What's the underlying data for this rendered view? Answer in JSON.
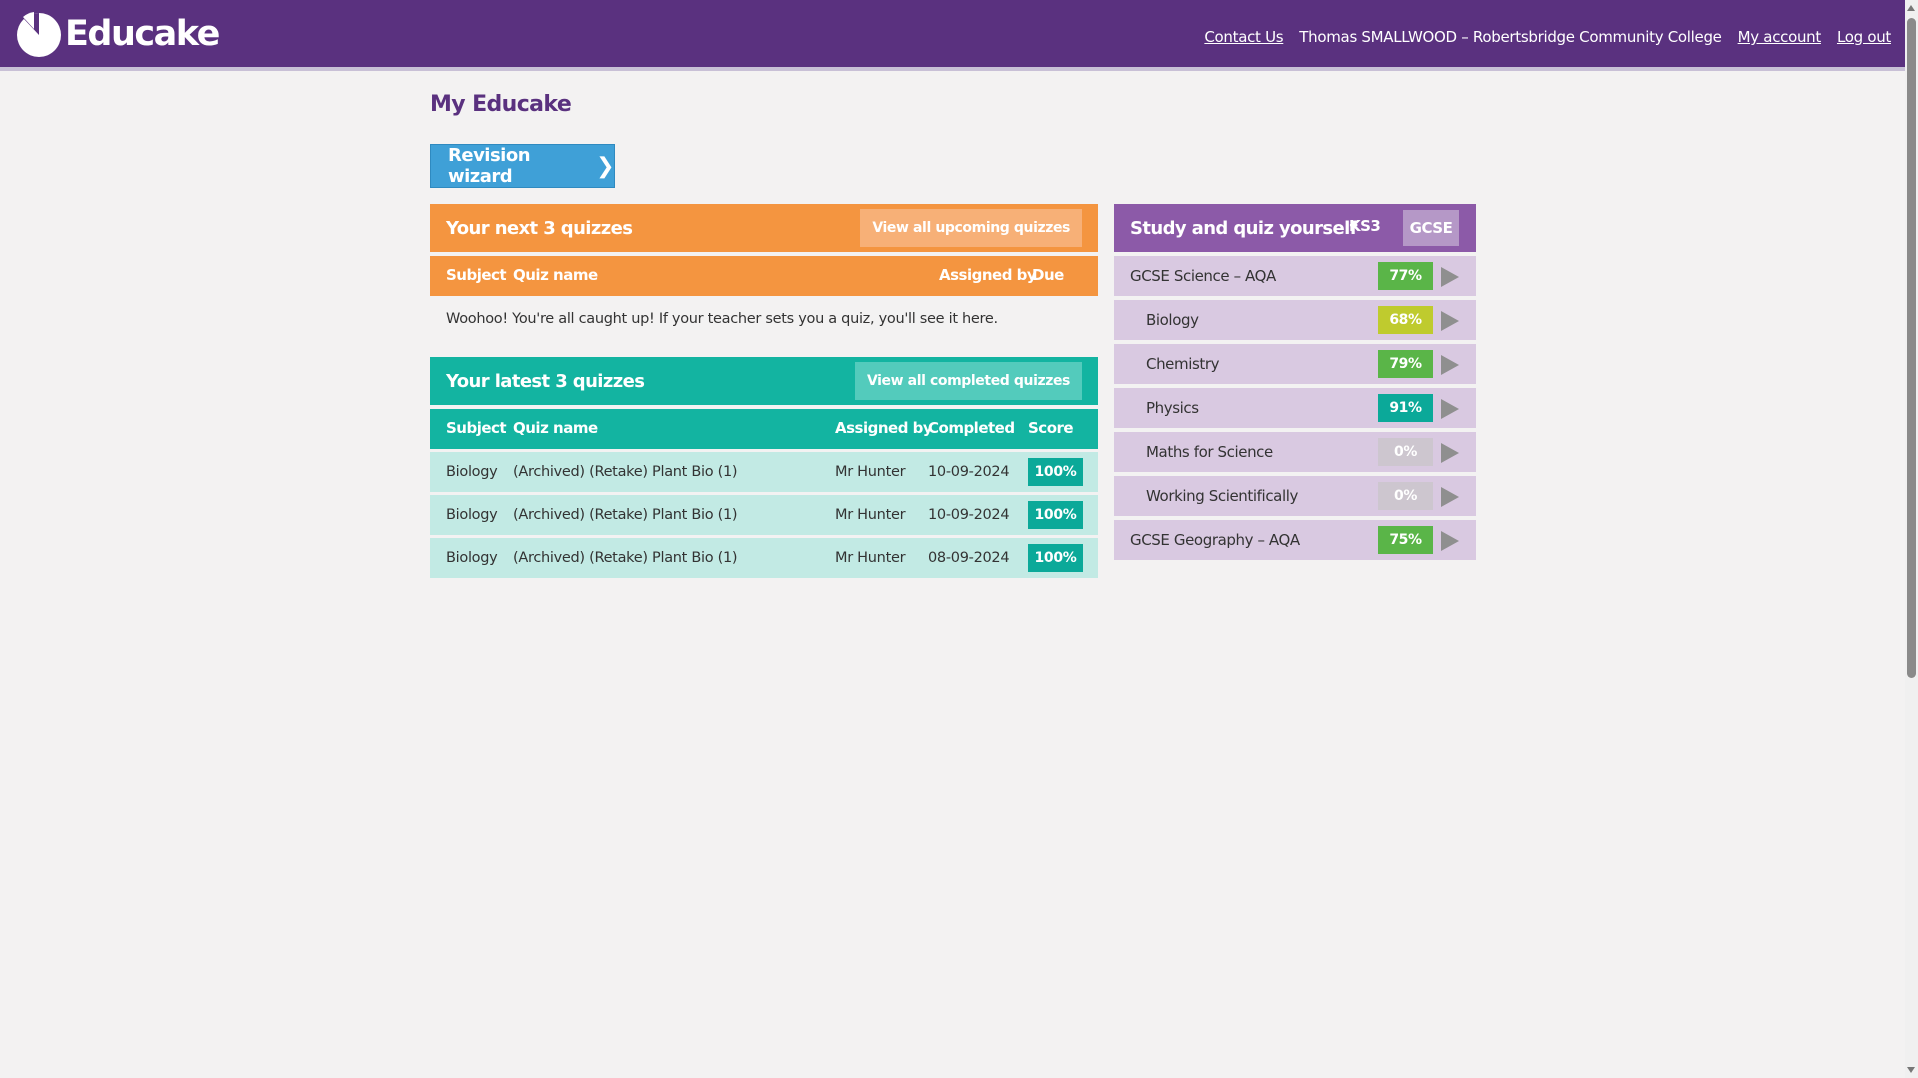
{
  "header": {
    "logo_text": "Educake",
    "contact": "Contact Us",
    "user": "Thomas SMALLWOOD – Robertsbridge Community College",
    "account": "My account",
    "logout": "Log out"
  },
  "page": {
    "title": "My Educake",
    "wizard_label": "Revision wizard"
  },
  "upcoming": {
    "title": "Your next 3 quizzes",
    "view_all": "View all upcoming quizzes",
    "columns": {
      "subject": "Subject",
      "quiz": "Quiz name",
      "assigned": "Assigned by",
      "due": "Due"
    },
    "empty_message": "Woohoo! You're all caught up! If your teacher sets you a quiz, you'll see it here."
  },
  "latest": {
    "title": "Your latest 3 quizzes",
    "view_all": "View all completed quizzes",
    "columns": {
      "subject": "Subject",
      "quiz": "Quiz name",
      "assigned": "Assigned by",
      "completed": "Completed",
      "score": "Score"
    },
    "rows": [
      {
        "subject": "Biology",
        "quiz": "(Archived) (Retake) Plant Bio (1)",
        "assigned": "Mr Hunter",
        "completed": "10-09-2024",
        "score": "100%"
      },
      {
        "subject": "Biology",
        "quiz": "(Archived) (Retake) Plant Bio (1)",
        "assigned": "Mr Hunter",
        "completed": "10-09-2024",
        "score": "100%"
      },
      {
        "subject": "Biology",
        "quiz": "(Archived) (Retake) Plant Bio (1)",
        "assigned": "Mr Hunter",
        "completed": "08-09-2024",
        "score": "100%"
      }
    ]
  },
  "study": {
    "title": "Study and quiz yourself",
    "tab_ks3": "KS3",
    "tab_gcse": "GCSE",
    "items": [
      {
        "label": "GCSE Science – AQA",
        "pct": "77%",
        "color": "#5ab548",
        "sub": false
      },
      {
        "label": "Biology",
        "pct": "68%",
        "color": "#bfcb2e",
        "sub": true
      },
      {
        "label": "Chemistry",
        "pct": "79%",
        "color": "#5ab548",
        "sub": true
      },
      {
        "label": "Physics",
        "pct": "91%",
        "color": "#0ba999",
        "sub": true
      },
      {
        "label": "Maths for Science",
        "pct": "0%",
        "color": "#cdc6cf",
        "sub": true
      },
      {
        "label": "Working Scientifically",
        "pct": "0%",
        "color": "#cdc6cf",
        "sub": true
      },
      {
        "label": "GCSE Geography – AQA",
        "pct": "75%",
        "color": "#5ab548",
        "sub": false
      }
    ]
  }
}
